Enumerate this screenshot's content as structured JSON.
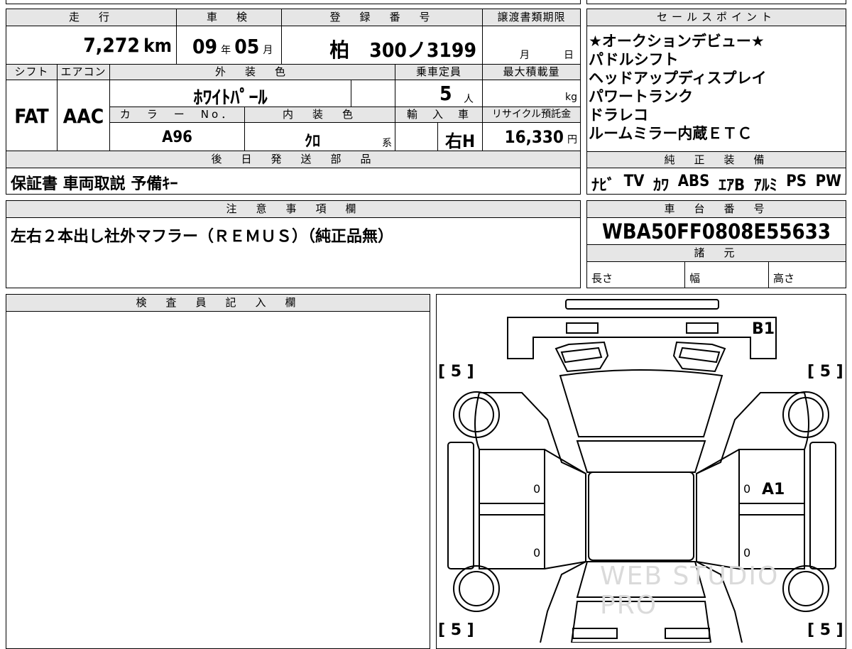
{
  "main": {
    "headers": {
      "mileage": "走　行",
      "inspection": "車　検",
      "registration": "登　録　番　号",
      "transfer_deadline": "譲渡書類期限",
      "shift": "シフト",
      "aircon": "エアコン",
      "exterior_color": "外　装　色",
      "capacity": "乗車定員",
      "max_load": "最大積載量",
      "color_no": "カ　ラ　ー　No．",
      "interior_color": "内　装　色",
      "import": "輸　入　車",
      "recycle_fee": "リサイクル預託金",
      "later_parts": "後　日　発　送　部　品"
    },
    "mileage_value": "7,272",
    "mileage_unit": "km",
    "inspection_year": "09",
    "inspection_year_unit": "年",
    "inspection_month": "05",
    "inspection_month_unit": "月",
    "registration_value": "柏　300ノ3199",
    "deadline_month_unit": "月",
    "deadline_day_unit": "日",
    "shift_value": "FAT",
    "aircon_value": "AAC",
    "exterior_value": "ﾎﾜｲﾄﾊﾟｰﾙ",
    "capacity_value": "5",
    "capacity_unit": "人",
    "max_load_unit": "kg",
    "color_no_value": "A96",
    "interior_value": "ｸﾛ",
    "interior_suffix": "系",
    "import_value": "右H",
    "recycle_value": "16,330",
    "recycle_unit": "円",
    "later_parts_value": "保証書 車両取説 予備ｷｰ"
  },
  "sales": {
    "header": "セールスポイント",
    "points": [
      "★オークションデビュー★",
      "パドルシフト",
      "ヘッドアップディスプレイ",
      "パワートランク",
      "ドラレコ",
      "ルームミラー内蔵ＥＴＣ"
    ]
  },
  "equipment": {
    "header": "純　正　装　備",
    "items": [
      "ﾅﾋﾞ",
      "TV",
      "ｶﾜ",
      "ABS",
      "ｴｱB",
      "ｱﾙﾐ",
      "PS",
      "PW"
    ]
  },
  "notes": {
    "header": "注　意　事　項　欄",
    "text": "左右２本出し社外マフラー（ＲＥＭＵＳ）（純正品無）"
  },
  "chassis": {
    "header": "車　台　番　号",
    "value": "WBA50FF0808E55633"
  },
  "specs": {
    "header": "諸　元",
    "length": "長さ",
    "width": "幅",
    "height": "高さ"
  },
  "inspector": {
    "header": "検　査　員　記　入　欄"
  },
  "diagram": {
    "tire_fl": "[ 5 ]",
    "tire_fr": "[ 5 ]",
    "tire_rl": "[ 5 ]",
    "tire_rr": "[ 5 ]",
    "mark_b1": "B1",
    "mark_a1": "A1",
    "zero": "0",
    "watermark": "WEB STUDIO PRO"
  }
}
